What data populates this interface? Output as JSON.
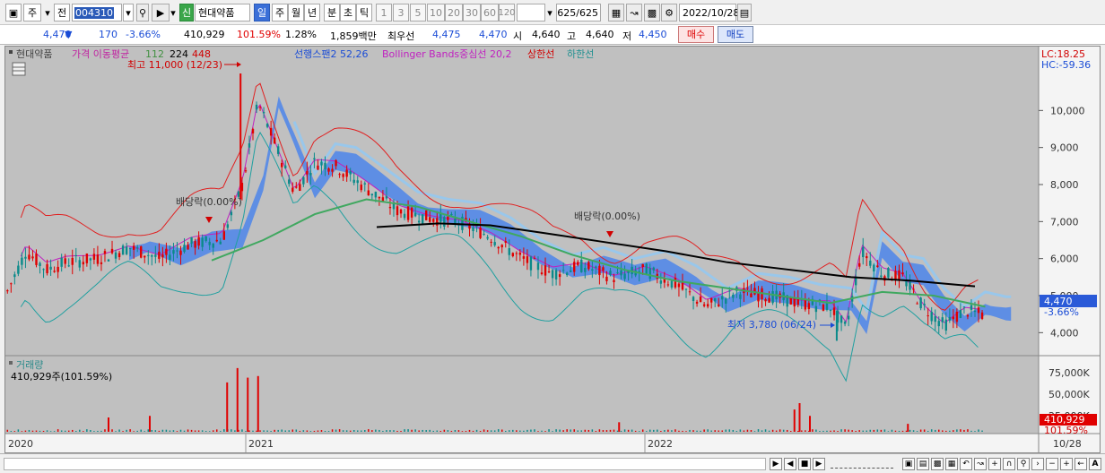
{
  "toolbar": {
    "market_label": "주",
    "mode_label": "전",
    "code_value": "004310",
    "new_badge": "신",
    "stock_name": "현대약품",
    "periods": [
      "일",
      "주",
      "월",
      "년",
      "분",
      "초",
      "틱"
    ],
    "intervals": [
      "1",
      "3",
      "5",
      "10",
      "20",
      "30",
      "60",
      "120"
    ],
    "count_value": "625",
    "count_total": "/625",
    "date_value": "2022/10/28"
  },
  "quote": {
    "price": "4,470",
    "change": "170",
    "change_pct": "-3.66%",
    "volume": "410,929",
    "volume_ratio": "101.59%",
    "turnover": "1.28%",
    "amount": "1,859백만",
    "best_ask_label": "최우선",
    "best_ask": "4,475",
    "best_bid": "4,470",
    "open_label": "시",
    "open": "4,640",
    "high_label": "고",
    "high": "4,640",
    "low_label": "저",
    "low": "4,450",
    "buy_label": "매수",
    "sell_label": "매도"
  },
  "legend": {
    "stock_name": "현대약품",
    "ma_label": "가격 이동평균",
    "ma_112": "112",
    "ma_224": "224",
    "ma_448": "448",
    "span2": "선행스팬2 52,26",
    "bollinger": "Bollinger Bands중심선 20,2",
    "upper": "상한선",
    "lower": "하한선",
    "lc": "LC:18.25",
    "hc": "HC:-59.36"
  },
  "annotations": {
    "high": "최고 11,000 (12/23)",
    "low": "최저 3,780 (06/24)",
    "dividend_1": "배당락(0.00%)",
    "dividend_2": "배당락(0.00%)"
  },
  "price_axis": {
    "ticks": [
      "10,000",
      "9,000",
      "8,000",
      "7,000",
      "6,000",
      "5,000",
      "4,000"
    ],
    "current_price": "4,470",
    "current_change": "-3.66%"
  },
  "volume_panel": {
    "title": "거래량",
    "value_label": "410,929주(101.59%)",
    "ticks": [
      "75,000K",
      "50,000K",
      "25,000K"
    ],
    "current": "410,929",
    "current_pct": "101.59%"
  },
  "time_axis": {
    "labels": [
      "2020",
      "2021",
      "2022"
    ],
    "end_label": "10/28"
  },
  "colors": {
    "up": "#e00000",
    "down": "#0a8a8a",
    "cloud": "#3d7df0",
    "cloud_light": "#8fc8f5",
    "ma_black": "#000000",
    "ma_green": "#40a860",
    "bb_upper": "#e02020",
    "bb_lower": "#20a0a0",
    "bb_mid": "#c020c0"
  },
  "chart_data": {
    "type": "candlestick",
    "y_range": [
      3500,
      11000
    ],
    "x_labels": [
      "2020",
      "2021",
      "2022"
    ],
    "price_series": [
      {
        "t": 0.0,
        "v": 5000
      },
      {
        "t": 0.02,
        "v": 6200
      },
      {
        "t": 0.04,
        "v": 5700
      },
      {
        "t": 0.06,
        "v": 5900
      },
      {
        "t": 0.09,
        "v": 6000
      },
      {
        "t": 0.12,
        "v": 6300
      },
      {
        "t": 0.15,
        "v": 6000
      },
      {
        "t": 0.18,
        "v": 6400
      },
      {
        "t": 0.21,
        "v": 6500
      },
      {
        "t": 0.23,
        "v": 8000
      },
      {
        "t": 0.245,
        "v": 10200
      },
      {
        "t": 0.26,
        "v": 9200
      },
      {
        "t": 0.28,
        "v": 7800
      },
      {
        "t": 0.3,
        "v": 8600
      },
      {
        "t": 0.32,
        "v": 8500
      },
      {
        "t": 0.35,
        "v": 7900
      },
      {
        "t": 0.38,
        "v": 7300
      },
      {
        "t": 0.41,
        "v": 7100
      },
      {
        "t": 0.44,
        "v": 7000
      },
      {
        "t": 0.47,
        "v": 6600
      },
      {
        "t": 0.5,
        "v": 6000
      },
      {
        "t": 0.53,
        "v": 5600
      },
      {
        "t": 0.56,
        "v": 5800
      },
      {
        "t": 0.59,
        "v": 5500
      },
      {
        "t": 0.62,
        "v": 5700
      },
      {
        "t": 0.65,
        "v": 5300
      },
      {
        "t": 0.68,
        "v": 4700
      },
      {
        "t": 0.71,
        "v": 5100
      },
      {
        "t": 0.74,
        "v": 5000
      },
      {
        "t": 0.77,
        "v": 4800
      },
      {
        "t": 0.8,
        "v": 4700
      },
      {
        "t": 0.815,
        "v": 4100
      },
      {
        "t": 0.83,
        "v": 6200
      },
      {
        "t": 0.85,
        "v": 5600
      },
      {
        "t": 0.87,
        "v": 5500
      },
      {
        "t": 0.89,
        "v": 4700
      },
      {
        "t": 0.91,
        "v": 4200
      },
      {
        "t": 0.93,
        "v": 4600
      },
      {
        "t": 0.95,
        "v": 4470
      }
    ],
    "ma_black": [
      {
        "t": 0.36,
        "v": 6850
      },
      {
        "t": 0.42,
        "v": 6950
      },
      {
        "t": 0.47,
        "v": 6900
      },
      {
        "t": 0.52,
        "v": 6700
      },
      {
        "t": 0.58,
        "v": 6450
      },
      {
        "t": 0.64,
        "v": 6200
      },
      {
        "t": 0.7,
        "v": 5900
      },
      {
        "t": 0.76,
        "v": 5700
      },
      {
        "t": 0.82,
        "v": 5500
      },
      {
        "t": 0.88,
        "v": 5400
      },
      {
        "t": 0.94,
        "v": 5250
      }
    ],
    "ma_green": [
      {
        "t": 0.2,
        "v": 5950
      },
      {
        "t": 0.25,
        "v": 6500
      },
      {
        "t": 0.3,
        "v": 7200
      },
      {
        "t": 0.35,
        "v": 7600
      },
      {
        "t": 0.4,
        "v": 7400
      },
      {
        "t": 0.45,
        "v": 7000
      },
      {
        "t": 0.5,
        "v": 6600
      },
      {
        "t": 0.55,
        "v": 6100
      },
      {
        "t": 0.6,
        "v": 5700
      },
      {
        "t": 0.65,
        "v": 5400
      },
      {
        "t": 0.7,
        "v": 5200
      },
      {
        "t": 0.75,
        "v": 5000
      },
      {
        "t": 0.8,
        "v": 4800
      },
      {
        "t": 0.85,
        "v": 5100
      },
      {
        "t": 0.9,
        "v": 5000
      },
      {
        "t": 0.95,
        "v": 4700
      }
    ],
    "volume_spikes": [
      {
        "t": 0.215,
        "v": 62000
      },
      {
        "t": 0.225,
        "v": 80000
      },
      {
        "t": 0.235,
        "v": 68000
      },
      {
        "t": 0.245,
        "v": 70000
      },
      {
        "t": 0.14,
        "v": 20000
      },
      {
        "t": 0.1,
        "v": 18000
      },
      {
        "t": 0.595,
        "v": 12000
      },
      {
        "t": 0.765,
        "v": 28000
      },
      {
        "t": 0.77,
        "v": 36000
      },
      {
        "t": 0.78,
        "v": 20000
      },
      {
        "t": 0.875,
        "v": 10000
      }
    ]
  }
}
